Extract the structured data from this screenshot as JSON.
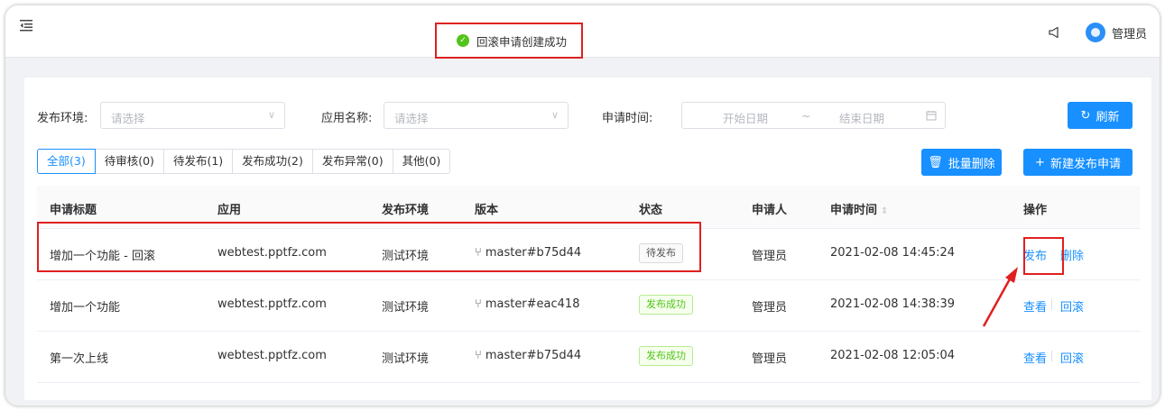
{
  "toast": {
    "message": "回滚申请创建成功"
  },
  "header": {
    "username": "管理员"
  },
  "filters": {
    "env_label": "发布环境:",
    "env_placeholder": "请选择",
    "app_label": "应用名称:",
    "app_placeholder": "请选择",
    "time_label": "申请时间:",
    "start_placeholder": "开始日期",
    "range_sep": "~",
    "end_placeholder": "结束日期",
    "refresh": "刷新"
  },
  "tabs": [
    "全部(3)",
    "待审核(0)",
    "待发布(1)",
    "发布成功(2)",
    "发布异常(0)",
    "其他(0)"
  ],
  "actions": {
    "batch_delete": "批量删除",
    "new_request": "新建发布申请"
  },
  "table": {
    "columns": [
      "申请标题",
      "应用",
      "发布环境",
      "版本",
      "状态",
      "申请人",
      "申请时间",
      "操作"
    ],
    "rows": [
      {
        "title": "增加一个功能 - 回滚",
        "app": "webtest.pptfz.com",
        "env": "测试环境",
        "version": "master#b75d44",
        "status": "待发布",
        "applicant": "管理员",
        "time": "2021-02-08 14:45:24",
        "action1": "发布",
        "action2": "删除"
      },
      {
        "title": "增加一个功能",
        "app": "webtest.pptfz.com",
        "env": "测试环境",
        "version": "master#eac418",
        "status": "发布成功",
        "applicant": "管理员",
        "time": "2021-02-08 14:38:39",
        "action1": "查看",
        "action2": "回滚"
      },
      {
        "title": "第一次上线",
        "app": "webtest.pptfz.com",
        "env": "测试环境",
        "version": "master#b75d44",
        "status": "发布成功",
        "applicant": "管理员",
        "time": "2021-02-08 12:05:04",
        "action1": "查看",
        "action2": "回滚"
      }
    ]
  },
  "colors": {
    "primary": "#1890ff",
    "success": "#52c41a",
    "highlight": "#e02020"
  },
  "icons": [
    "menu-fold-icon",
    "check-circle-icon",
    "notification-icon",
    "avatar-icon",
    "chevron-down-icon",
    "calendar-icon",
    "refresh-icon",
    "delete-icon",
    "plus-icon",
    "branch-icon",
    "sort-icon",
    "arrow-annotation-icon"
  ]
}
